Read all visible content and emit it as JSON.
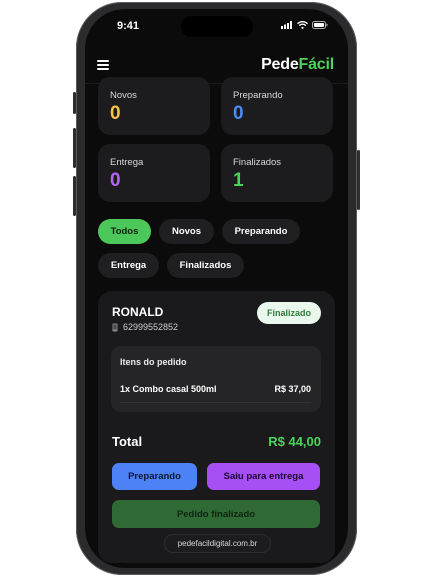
{
  "status_bar": {
    "time": "9:41"
  },
  "header": {
    "logo_part1": "Pede",
    "logo_part2": "Fácil"
  },
  "stats": [
    {
      "label": "Novos",
      "value": "0",
      "color": "#f5c542"
    },
    {
      "label": "Preparando",
      "value": "0",
      "color": "#4d8cf5"
    },
    {
      "label": "Entrega",
      "value": "0",
      "color": "#b066f5"
    },
    {
      "label": "Finalizados",
      "value": "1",
      "color": "#4cd35a"
    }
  ],
  "filters": [
    "Todos",
    "Novos",
    "Preparando",
    "Entrega",
    "Finalizados"
  ],
  "active_filter": "Todos",
  "order": {
    "customer": "RONALD",
    "phone": "62999552852",
    "status": "Finalizado",
    "items_title": "Itens do pedido",
    "items": [
      {
        "name": "1x Combo casal 500ml",
        "price": "R$ 37,00"
      }
    ],
    "total_label": "Total",
    "total_value": "R$ 44,00",
    "actions": {
      "preparando": "Preparando",
      "saiu": "Saiu para entrega",
      "finalizado": "Pedido finalizado"
    }
  },
  "url": "pedefacildigital.com.br",
  "colors": {
    "accent_green": "#4cd35a",
    "blue": "#4d82f6",
    "purple": "#a64ff5"
  }
}
